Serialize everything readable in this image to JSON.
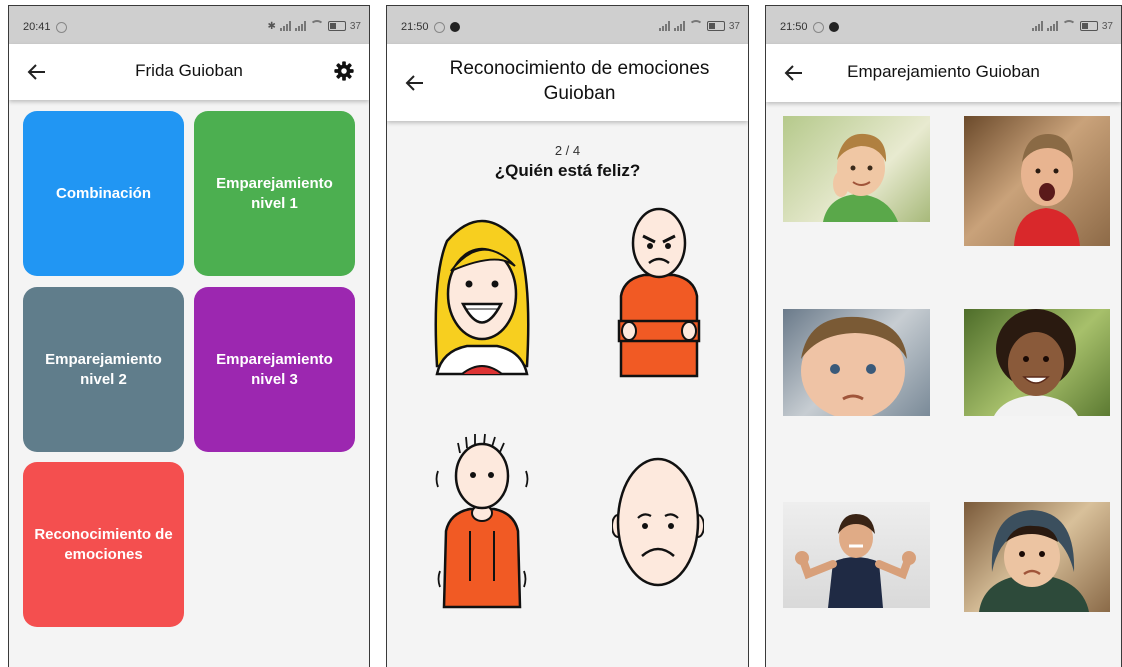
{
  "screen1": {
    "status_time": "20:41",
    "status_battery": "37",
    "title": "Frida Guioban",
    "tiles": [
      {
        "label": "Combinación",
        "color": "#2196f3"
      },
      {
        "label": "Emparejamiento nivel 1",
        "color": "#4caf50"
      },
      {
        "label": "Emparejamiento nivel 2",
        "color": "#607d8b"
      },
      {
        "label": "Emparejamiento nivel 3",
        "color": "#9c27b0"
      },
      {
        "label": "Reconocimiento de emociones",
        "color": "#f44f4f"
      }
    ]
  },
  "screen2": {
    "status_time": "21:50",
    "status_battery": "37",
    "title_line1": "Reconocimiento de emociones",
    "title_line2": "Guioban",
    "progress": "2 / 4",
    "question": "¿Quién está feliz?",
    "options": [
      "happy-girl-pictogram",
      "angry-boy-pictogram",
      "nervous-boy-pictogram",
      "sad-face-pictogram"
    ]
  },
  "screen3": {
    "status_time": "21:50",
    "status_battery": "37",
    "title": "Emparejamiento Guioban",
    "photos": [
      "thumbs-up-child-photo",
      "shouting-child-photo",
      "tearful-child-photo",
      "smiling-child-photo",
      "angry-girl-photo",
      "hooded-child-photo"
    ]
  }
}
